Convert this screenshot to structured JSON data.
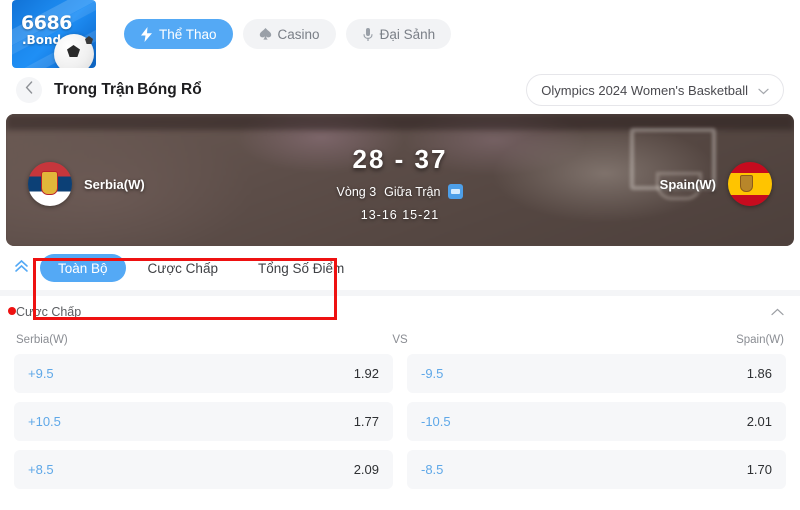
{
  "topnav": {
    "logo": {
      "brand": "6686",
      "domain": ".Bond",
      "ball_icon": "soccer-ball-icon"
    },
    "pills": [
      {
        "label": "Thể Thao",
        "icon": "lightning-bolt-icon",
        "active": true
      },
      {
        "label": "Casino",
        "icon": "spade-icon",
        "active": false
      },
      {
        "label": "Đại Sảnh",
        "icon": "microphone-icon",
        "active": false
      }
    ]
  },
  "breadcrumb": {
    "back_icon": "chevron-left-icon",
    "title_primary": "Trong Trận",
    "title_secondary": "Bóng Rổ",
    "league_label": "Olympics 2024 Women's Basketball",
    "league_chevron_icon": "chevron-down-icon"
  },
  "scoreboard": {
    "home_team": "Serbia(W)",
    "away_team": "Spain(W)",
    "home_flag": "serbia-flag-icon",
    "away_flag": "spain-flag-icon",
    "score": "28 - 37",
    "period": "Vòng 3",
    "status": "Giữa Trận",
    "live_icon": "live-stream-icon",
    "period_scores": "13-16   15-21"
  },
  "tabbar": {
    "collapse_icon": "double-chevron-up-icon",
    "tabs": [
      {
        "label": "Toàn Bộ",
        "active": true
      },
      {
        "label": "Cược Chấp",
        "active": false
      },
      {
        "label": "Tổng Số Điểm",
        "active": false
      }
    ]
  },
  "market": {
    "title": "Cược Chấp",
    "collapse_icon": "chevron-up-icon",
    "columns": {
      "left": "Serbia(W)",
      "center": "VS",
      "right": "Spain(W)"
    },
    "rows": [
      {
        "home_handicap": "+9.5",
        "home_price": "1.92",
        "away_handicap": "-9.5",
        "away_price": "1.86"
      },
      {
        "home_handicap": "+10.5",
        "home_price": "1.77",
        "away_handicap": "-10.5",
        "away_price": "2.01"
      },
      {
        "home_handicap": "+8.5",
        "home_price": "2.09",
        "away_handicap": "-8.5",
        "away_price": "1.70"
      }
    ]
  },
  "annotations": {
    "highlight_color": "#ee1111",
    "marker_color": "#ee1111"
  },
  "colors": {
    "accent_blue": "#54a9f5",
    "handicap_blue": "#5fa8e8",
    "panel_gray": "#f6f7f9"
  }
}
